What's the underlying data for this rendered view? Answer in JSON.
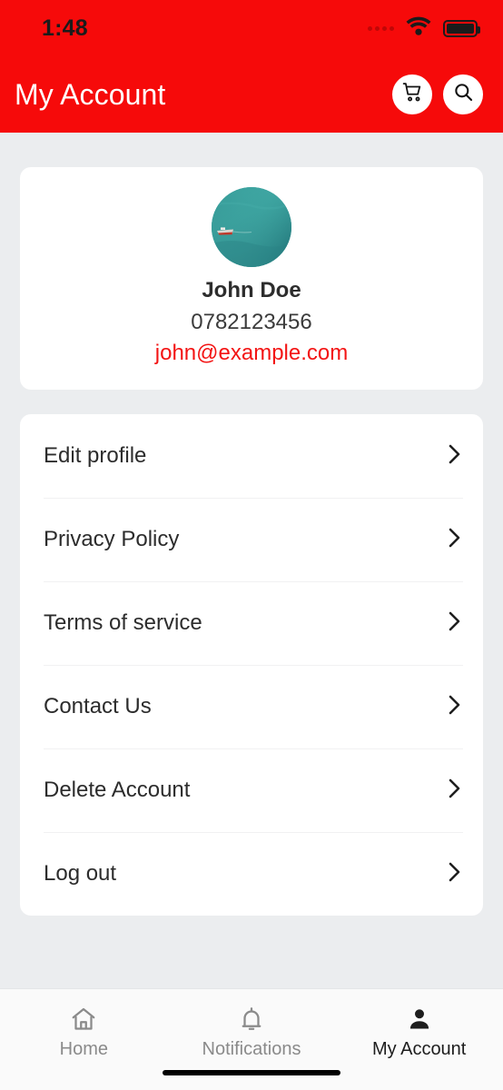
{
  "status_bar": {
    "time": "1:48",
    "cellular_icon": "cellular-dots-icon",
    "wifi_icon": "wifi-icon",
    "battery_icon": "battery-full-icon"
  },
  "app_bar": {
    "title": "My Account",
    "cart_icon": "shopping-cart-icon",
    "search_icon": "search-icon",
    "background_color": "#f60a0a",
    "title_color": "#ffffff"
  },
  "profile": {
    "avatar_alt": "profile-photo",
    "name": "John Doe",
    "phone": "0782123456",
    "email": "john@example.com",
    "email_color": "#f31414"
  },
  "menu": {
    "items": [
      {
        "label": "Edit profile",
        "chevron": "chevron-right-icon"
      },
      {
        "label": "Privacy Policy",
        "chevron": "chevron-right-icon"
      },
      {
        "label": "Terms of service",
        "chevron": "chevron-right-icon"
      },
      {
        "label": "Contact Us",
        "chevron": "chevron-right-icon"
      },
      {
        "label": "Delete Account",
        "chevron": "chevron-right-icon"
      },
      {
        "label": "Log out",
        "chevron": "chevron-right-icon"
      }
    ]
  },
  "bottom_nav": {
    "items": [
      {
        "label": "Home",
        "icon": "home-icon",
        "active": false
      },
      {
        "label": "Notifications",
        "icon": "bell-icon",
        "active": false
      },
      {
        "label": "My Account",
        "icon": "person-icon",
        "active": true
      }
    ],
    "active_color": "#1d1d1d",
    "inactive_color": "#8a8a8a"
  }
}
